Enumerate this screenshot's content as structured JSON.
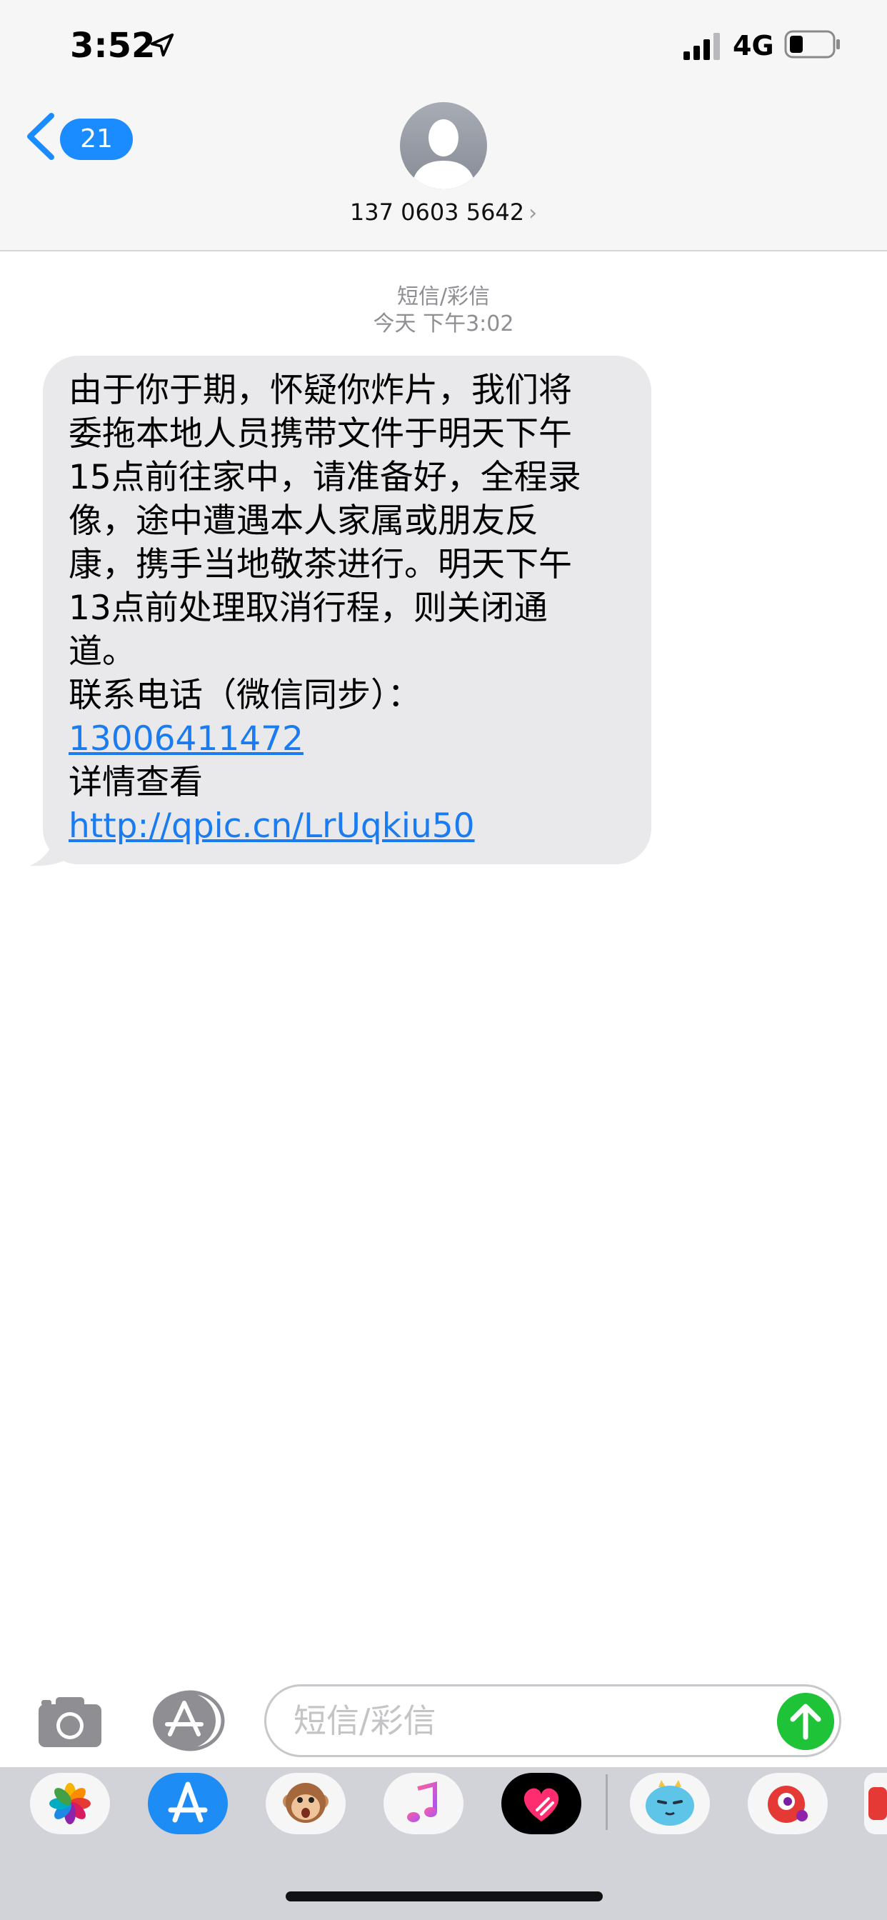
{
  "status_bar": {
    "time": "3:52",
    "network": "4G"
  },
  "header": {
    "back_badge": "21",
    "contact_number": "137 0603 5642",
    "chevron": "›"
  },
  "conversation": {
    "service_label": "短信/彩信",
    "timestamp": "今天 下午3:02",
    "message_lines": [
      "由于你于期，怀疑你炸片，我们将",
      "委拖本地人员携带文件于明天下午",
      "15点前往家中，请准备好，全程录",
      "像，途中遭遇本人家属或朋友反",
      "康，携手当地敬茶进行。明天下午",
      "13点前处理取消行程，则关闭通",
      "道。",
      "联系电话（微信同步）："
    ],
    "phone_link": "13006411472",
    "detail_label": "详情查看",
    "url_link": "http://qpic.cn/LrUqkiu50"
  },
  "input_bar": {
    "placeholder": "短信/彩信"
  },
  "colors": {
    "accent": "#1a8cff",
    "send": "#1fc337",
    "bubble": "#e9e9eb",
    "link": "#1a7cf0"
  },
  "app_drawer": [
    "photos-icon",
    "app-store-icon",
    "animoji-icon",
    "music-icon",
    "digital-touch-icon",
    "sticker-monster-icon",
    "game-icon"
  ]
}
